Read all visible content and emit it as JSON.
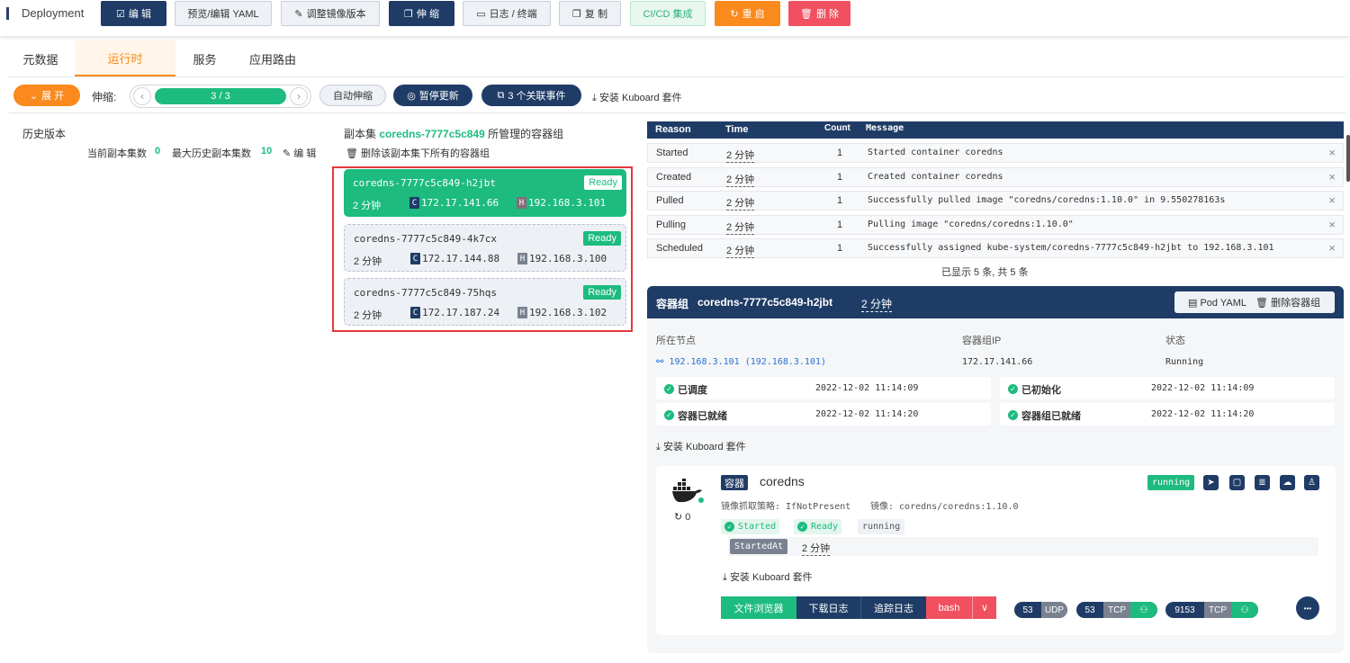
{
  "toolbar": {
    "title": "Deployment",
    "buttons": [
      {
        "label": "编 辑",
        "icon": "edit-icon"
      },
      {
        "label": "预览/编辑 YAML",
        "icon": ""
      },
      {
        "label": "调整镜像版本",
        "icon": "pen-icon"
      },
      {
        "label": "伸 缩",
        "icon": "copy-icon"
      },
      {
        "label": "日志 / 终端",
        "icon": "monitor-icon"
      },
      {
        "label": "复 制",
        "icon": "copy-icon"
      },
      {
        "label": "CI/CD 集成",
        "icon": ""
      },
      {
        "label": "重 启",
        "icon": "refresh-icon"
      },
      {
        "label": "删 除",
        "icon": "trash-icon"
      }
    ]
  },
  "tabs": [
    {
      "label": "元数据"
    },
    {
      "label": "运行时"
    },
    {
      "label": "服务"
    },
    {
      "label": "应用路由"
    }
  ],
  "controls": {
    "expand": "展 开",
    "scale_label": "伸缩:",
    "scale_value": "3 / 3",
    "auto_scale": "自动伸缩",
    "pause": "暂停更新",
    "events": "3 个关联事件",
    "install": "安装 Kuboard 套件"
  },
  "history": {
    "title": "历史版本",
    "current_label": "当前副本集数",
    "current_value": "0",
    "max_label": "最大历史副本集数",
    "max_value": "10",
    "edit": "编 辑"
  },
  "replicaset": {
    "prefix": "副本集",
    "name": "coredns-7777c5c849",
    "suffix": "所管理的容器组",
    "delete": "删除该副本集下所有的容器组"
  },
  "pods": [
    {
      "name": "coredns-7777c5c849-h2jbt",
      "status": "Ready",
      "age": "2 分钟",
      "c": "C",
      "cip": "172.17.141.66",
      "h": "H",
      "hip": "192.168.3.101"
    },
    {
      "name": "coredns-7777c5c849-4k7cx",
      "status": "Ready",
      "age": "2 分钟",
      "c": "C",
      "cip": "172.17.144.88",
      "h": "H",
      "hip": "192.168.3.100"
    },
    {
      "name": "coredns-7777c5c849-75hqs",
      "status": "Ready",
      "age": "2 分钟",
      "c": "C",
      "cip": "172.17.187.24",
      "h": "H",
      "hip": "192.168.3.102"
    }
  ],
  "events": {
    "headers": {
      "reason": "Reason",
      "time": "Time",
      "count": "Count",
      "message": "Message"
    },
    "rows": [
      {
        "reason": "Started",
        "time": "2 分钟",
        "count": "1",
        "message": "Started container coredns"
      },
      {
        "reason": "Created",
        "time": "2 分钟",
        "count": "1",
        "message": "Created container coredns"
      },
      {
        "reason": "Pulled",
        "time": "2 分钟",
        "count": "1",
        "message": "Successfully pulled image \"coredns/coredns:1.10.0\" in 9.550278163s"
      },
      {
        "reason": "Pulling",
        "time": "2 分钟",
        "count": "1",
        "message": "Pulling image \"coredns/coredns:1.10.0\""
      },
      {
        "reason": "Scheduled",
        "time": "2 分钟",
        "count": "1",
        "message": "Successfully assigned kube-system/coredns-7777c5c849-h2jbt to 192.168.3.101"
      }
    ],
    "summary": "已显示 5 条, 共 5 条",
    "close": "×"
  },
  "detail": {
    "label": "容器组",
    "name": "coredns-7777c5c849-h2jbt",
    "age": "2 分钟",
    "pod_yaml": "Pod YAML",
    "delete": "删除容器组",
    "node_label": "所在节点",
    "node_value": "192.168.3.101 (192.168.3.101)",
    "ip_label": "容器组IP",
    "ip_value": "172.17.141.66",
    "status_label": "状态",
    "status_value": "Running",
    "conditions": [
      {
        "name": "已调度",
        "time": "2022-12-02 11:14:09"
      },
      {
        "name": "已初始化",
        "time": "2022-12-02 11:14:09"
      },
      {
        "name": "容器已就绪",
        "time": "2022-12-02 11:14:20"
      },
      {
        "name": "容器组已就绪",
        "time": "2022-12-02 11:14:20"
      }
    ],
    "install": "安装 Kuboard 套件"
  },
  "container": {
    "tag": "容器",
    "name": "coredns",
    "state": "running",
    "restarts": "0",
    "pull_policy": "镜像抓取策略: IfNotPresent",
    "image": "镜像: coredns/coredns:1.10.0",
    "chip_started": "Started",
    "chip_ready": "Ready",
    "chip_running": "running",
    "started_at_label": "StartedAt",
    "started_at_value": "2 分钟",
    "install": "安装 Kuboard 套件",
    "actions": {
      "files": "文件浏览器",
      "download": "下载日志",
      "follow": "追踪日志",
      "shell": "bash",
      "caret": "∨"
    },
    "ports": [
      {
        "port": "53",
        "proto": "UDP"
      },
      {
        "port": "53",
        "proto": "TCP"
      },
      {
        "port": "9153",
        "proto": "TCP"
      }
    ],
    "more": "•••",
    "colors": {
      "primary": "#1f3c66",
      "green": "#1dbb7f",
      "orange": "#fa8a1e",
      "red": "#f05060"
    }
  }
}
